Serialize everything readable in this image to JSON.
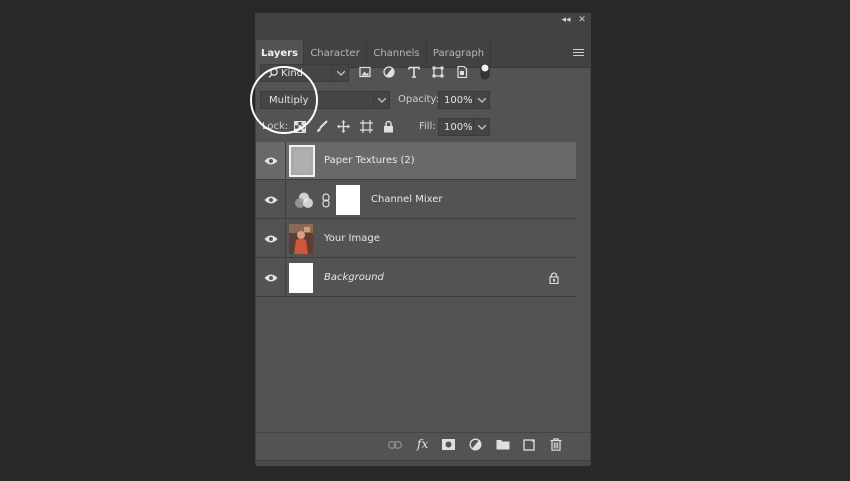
{
  "tabs": [
    {
      "label": "Layers",
      "active": true
    },
    {
      "label": "Character",
      "active": false
    },
    {
      "label": "Channels",
      "active": false
    },
    {
      "label": "Paragraph",
      "active": false
    }
  ],
  "filter": {
    "kind_label": "Kind"
  },
  "blend": {
    "mode": "Multiply",
    "opacity_label": "Opacity:",
    "opacity": "100%"
  },
  "lock": {
    "label": "Lock:",
    "fill_label": "Fill:",
    "fill": "100%"
  },
  "layers": [
    {
      "name": "Paper Textures (2)",
      "selected": true,
      "italic": false
    },
    {
      "name": "Channel Mixer",
      "selected": false,
      "italic": false
    },
    {
      "name": "Your Image",
      "selected": false,
      "italic": false
    },
    {
      "name": "Background",
      "selected": false,
      "italic": true
    }
  ],
  "footer": {
    "fx_label": "fx"
  },
  "colors": {
    "panel": "#535353",
    "selected_row": "#696969",
    "tabbar": "#424242",
    "background": "#282828"
  }
}
